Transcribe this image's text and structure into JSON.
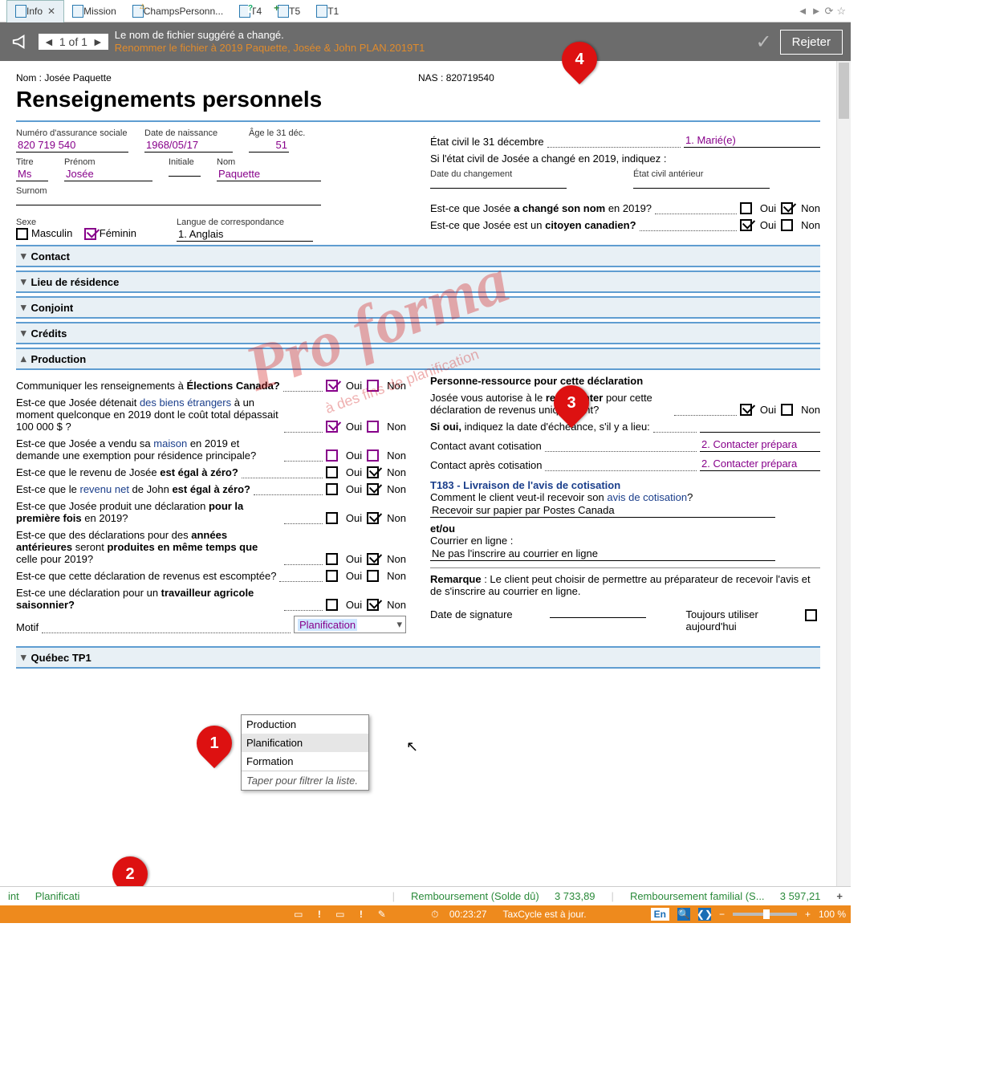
{
  "tabs": [
    {
      "label": "Info",
      "active": true,
      "closeable": true,
      "icon": "doc"
    },
    {
      "label": "Mission",
      "icon": "doc"
    },
    {
      "label": "ChampsPersonn...",
      "icon": "warn"
    },
    {
      "label": "T4",
      "icon": "q"
    },
    {
      "label": "T5",
      "icon": "plus"
    },
    {
      "label": "T1",
      "icon": "doc"
    }
  ],
  "notif": {
    "pager": "1 of 1",
    "line1": "Le nom de fichier suggéré a changé.",
    "line2": "Renommer le fichier à 2019 Paquette, Josée & John PLAN.2019T1",
    "reject": "Rejeter"
  },
  "header": {
    "name_label": "Nom : ",
    "name_value": "Josée Paquette",
    "nas_label": "NAS : ",
    "nas_value": "820719540",
    "title": "Renseignements personnels"
  },
  "ident": {
    "sin_label": "Numéro d'assurance sociale",
    "sin": "820 719 540",
    "dob_label": "Date de naissance",
    "dob": "1968/05/17",
    "age_label": "Âge le 31 déc.",
    "age": "51",
    "title_label": "Titre",
    "title": "Ms",
    "firstname_label": "Prénom",
    "firstname": "Josée",
    "initial_label": "Initiale",
    "initial": "",
    "lastname_label": "Nom",
    "lastname": "Paquette",
    "surname_label": "Surnom",
    "surname": "",
    "sex_label": "Sexe",
    "sex_m": "Masculin",
    "sex_f": "Féminin",
    "lang_label": "Langue de correspondance",
    "lang": "1. Anglais"
  },
  "marital": {
    "status_label": "État civil le 31 décembre",
    "status": "1. Marié(e)",
    "change_prompt": "Si l'état civil de Josée a changé en 2019, indiquez :",
    "date_change_label": "Date du changement",
    "prev_status_label": "État civil antérieur",
    "name_change_q": "Est-ce que Josée a changé son nom en 2019?",
    "citizen_q": "Est-ce que Josée est un citoyen canadien?",
    "oui": "Oui",
    "non": "Non"
  },
  "sections": {
    "contact": "Contact",
    "residence": "Lieu de résidence",
    "conjoint": "Conjoint",
    "credits": "Crédits",
    "production": "Production",
    "quebec": "Québec TP1"
  },
  "prod": {
    "q_elections_pre": "Communiquer les renseignements à ",
    "q_elections_bold": "Élections Canada?",
    "q_foreign_pre": "Est-ce que Josée détenait ",
    "q_foreign_link": "des biens étrangers",
    "q_foreign_post": " à un moment quelconque en 2019 dont le coût total dépassait 100 000 $ ?",
    "q_house_pre": "Est-ce que Josée a vendu sa ",
    "q_house_link": "maison",
    "q_house_post": " en 2019 et demande une exemption pour résidence principale?",
    "q_zero_pre": "Est-ce que le revenu de Josée ",
    "q_zero_bold": "est égal à zéro?",
    "q_netzero_pre": "Est-ce que le ",
    "q_netzero_link": "revenu net",
    "q_netzero_mid": " de John ",
    "q_netzero_bold": "est égal à zéro?",
    "q_first_pre": "Est-ce que Josée produit une déclaration ",
    "q_first_bold": "pour la première fois",
    "q_first_post": " en 2019?",
    "q_prior_pre": "Est-ce que des déclarations pour des ",
    "q_prior_bold1": "années antérieures",
    "q_prior_mid": " seront ",
    "q_prior_bold2": "produites en même temps que",
    "q_prior_post": " celle pour 2019?",
    "q_discount": "Est-ce que cette déclaration de revenus est escomptée?",
    "q_agri_pre": "Est-ce une déclaration pour un ",
    "q_agri_bold": "travailleur agricole saisonnier?",
    "motif_label": "Motif",
    "motif_value": "Planification",
    "motif_options": [
      "Production",
      "Planification",
      "Formation"
    ],
    "motif_hint": "Taper pour filtrer la liste.",
    "oui": "Oui",
    "non": "Non"
  },
  "contact_right": {
    "heading": "Personne-ressource pour cette déclaration",
    "auth_pre": "Josée vous autorise à le ",
    "auth_bold": "représenter",
    "auth_post": " pour cette déclaration de revenus uniquement?",
    "if_yes": "Si oui,",
    "if_yes_post": " indiquez la date d'échéance, s'il y a lieu:",
    "before_label": "Contact avant cotisation",
    "after_label": "Contact après cotisation",
    "contact_value": "2. Contacter prépara",
    "t183_heading": "T183 - Livraison de l'avis de cotisation",
    "how_pre": "Comment le client veut-il recevoir son ",
    "how_link": "avis de cotisation",
    "delivery": "Recevoir sur papier par Postes Canada",
    "etou": "et/ou",
    "mail_label": "Courrier en ligne :",
    "mail_value": "Ne pas l'inscrire au courrier en ligne",
    "remark_bold": "Remarque",
    "remark_text": " : Le client peut choisir de permettre au préparateur de recevoir l'avis et de s'inscrire au courrier en ligne.",
    "sign_date": "Date de signature",
    "always_today": "Toujours utiliser aujourd'hui",
    "oui": "Oui",
    "non": "Non"
  },
  "greenbar": {
    "seg1a": "int",
    "seg1b": "Planificati",
    "refund_label": "Remboursement (Solde dû)",
    "refund_value": "3 733,89",
    "family_label": "Remboursement familial (S...",
    "family_value": "3 597,21"
  },
  "orangebar": {
    "timer": "00:23:27",
    "status": "TaxCycle est à jour.",
    "lang": "En",
    "zoom": "100 %"
  },
  "watermark": "Pro forma",
  "watermark_sub": "à des fins de planification"
}
